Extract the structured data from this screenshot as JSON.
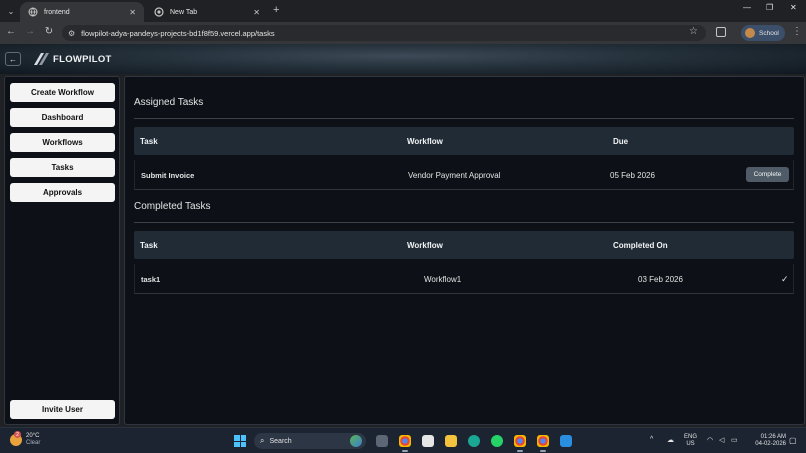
{
  "browser": {
    "tabs": [
      {
        "label": "frontend",
        "active": true
      },
      {
        "label": "New Tab",
        "active": false
      }
    ],
    "url": "flowpilot-adya-pandeys-projects-bd1f8f59.vercel.app/tasks",
    "profile_label": "School",
    "window_controls": {
      "minimize": "—",
      "restore": "❐",
      "close": "✕"
    }
  },
  "app": {
    "brand": "FLOWPILOT",
    "back_icon": "arrow-left-icon"
  },
  "sidebar": {
    "items": [
      {
        "label": "Create Workflow"
      },
      {
        "label": "Dashboard"
      },
      {
        "label": "Workflows"
      },
      {
        "label": "Tasks"
      },
      {
        "label": "Approvals"
      }
    ],
    "footer_button": "Invite User"
  },
  "assigned": {
    "title": "Assigned Tasks",
    "headers": [
      "Task",
      "Workflow",
      "Due"
    ],
    "rows": [
      {
        "task": "Submit Invoice",
        "workflow": "Vendor Payment Approval",
        "due": "05 Feb 2026",
        "action": "Complete"
      }
    ]
  },
  "completed": {
    "title": "Completed Tasks",
    "headers": [
      "Task",
      "Workflow",
      "Completed On"
    ],
    "rows": [
      {
        "task": "task1",
        "workflow": "Workflow1",
        "completed_on": "03 Feb 2026",
        "status_icon": "✓"
      }
    ]
  },
  "taskbar": {
    "weather_temp": "20°C",
    "weather_desc": "Clear",
    "weather_badge": "2",
    "search_label": "Search",
    "lang_top": "ENG",
    "lang_bottom": "US",
    "time": "01:26 AM",
    "date": "04-02-2026"
  },
  "colors": {
    "accent": "#4cc2ff",
    "panel_bg": "#0d1117",
    "table_header_bg": "#202b36",
    "sidebar_button_bg": "#f4f4f4",
    "complete_button_bg": "#4f5b66"
  }
}
